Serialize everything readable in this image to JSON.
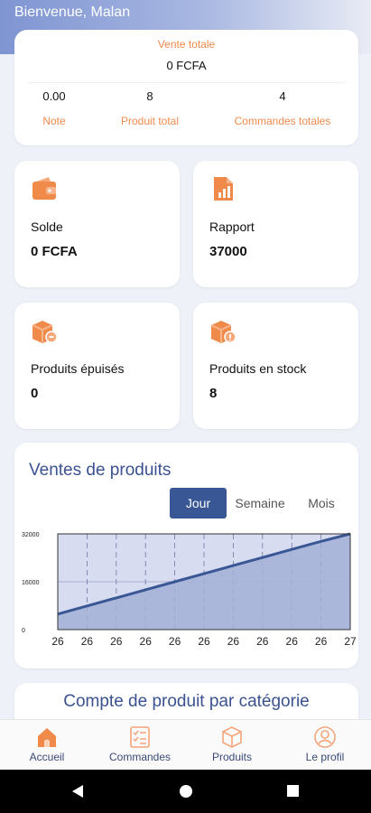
{
  "header": {
    "greeting": "Bienvenue, Malan"
  },
  "summary": {
    "title": "Vente totale",
    "value": "0 FCFA",
    "stats": [
      {
        "value": "0.00",
        "label": "Note"
      },
      {
        "value": "8",
        "label": "Produit total"
      },
      {
        "value": "4",
        "label": "Commandes totales"
      }
    ]
  },
  "tiles": [
    {
      "label": "Solde",
      "value": "0 FCFA",
      "icon": "wallet-icon"
    },
    {
      "label": "Rapport",
      "value": "37000",
      "icon": "report-icon"
    },
    {
      "label": "Produits épuisés",
      "value": "0",
      "icon": "box-out-icon"
    },
    {
      "label": "Produits en stock",
      "value": "8",
      "icon": "box-stock-icon"
    }
  ],
  "chart": {
    "title": "Ventes de produits",
    "tabs": [
      "Jour",
      "Semaine",
      "Mois"
    ],
    "active_tab": "Jour"
  },
  "chart_data": {
    "type": "area",
    "title": "Ventes de produits",
    "x": [
      "26",
      "26",
      "26",
      "26",
      "26",
      "26",
      "26",
      "26",
      "26",
      "26",
      "27"
    ],
    "series": [
      {
        "values": [
          5200,
          7900,
          10600,
          13300,
          16000,
          18700,
          21400,
          24100,
          26800,
          29500,
          32000
        ]
      }
    ],
    "y_ticks": [
      "32000",
      "16000",
      "0"
    ],
    "ylim": [
      0,
      32000
    ],
    "grid": true,
    "colors": {
      "line": "#3a5795",
      "fill": "#a3b0d6",
      "plot_bg": "#d7dcf1"
    }
  },
  "category_section": {
    "title": "Compte de produit par catégorie"
  },
  "nav": [
    {
      "label": "Accueil",
      "icon": "home-icon"
    },
    {
      "label": "Commandes",
      "icon": "orders-icon"
    },
    {
      "label": "Produits",
      "icon": "products-icon"
    },
    {
      "label": "Le profil",
      "icon": "profile-icon"
    }
  ],
  "colors": {
    "accent": "#f08a4b",
    "primary": "#3a5795",
    "title": "#3b5291"
  }
}
